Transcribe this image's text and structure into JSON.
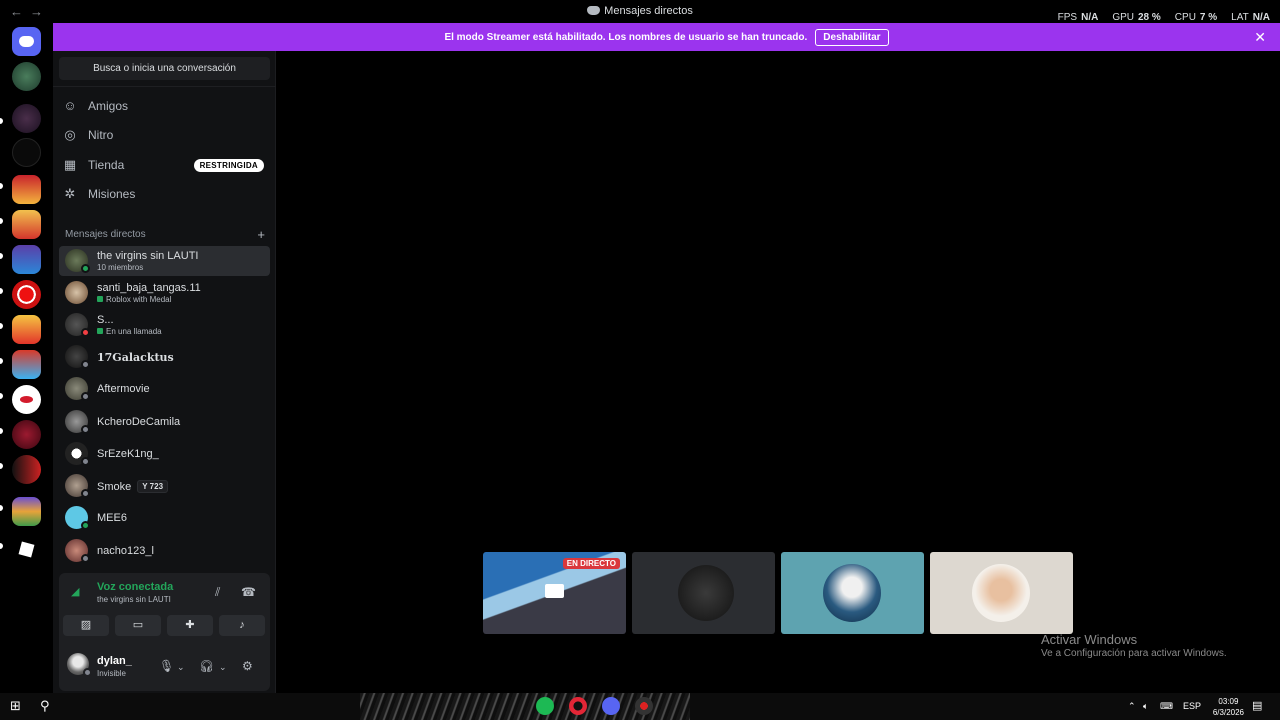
{
  "window": {
    "title": "Mensajes directos",
    "stats": [
      {
        "label": "FPS",
        "value": "N/A"
      },
      {
        "label": "GPU",
        "value": "28 %"
      },
      {
        "label": "CPU",
        "value": "7 %"
      },
      {
        "label": "LAT",
        "value": "N/A"
      }
    ]
  },
  "banner": {
    "text": "El modo Streamer está habilitado. Los nombres de usuario se han truncado.",
    "button": "Deshabilitar"
  },
  "sidebar": {
    "search_label": "Busca o inicia una conversación",
    "nav": [
      {
        "label": "Amigos",
        "icon": "friends-icon"
      },
      {
        "label": "Nitro",
        "icon": "nitro-icon"
      },
      {
        "label": "Tienda",
        "icon": "shop-icon",
        "badge": "RESTRINGIDA"
      },
      {
        "label": "Misiones",
        "icon": "quests-icon"
      }
    ],
    "dm_header": "Mensajes directos",
    "dms": [
      {
        "name": "the virgins sin LAUTI",
        "sub": "10 miembros",
        "active": true
      },
      {
        "name": "santi_baja_tangas.11",
        "sub": "Roblox with Medal",
        "status": "online"
      },
      {
        "name": "S...",
        "sub": "En una llamada",
        "status": "dnd"
      },
      {
        "name": "17Galacktus",
        "status": "offline"
      },
      {
        "name": "Aftermovie",
        "status": "offline"
      },
      {
        "name": "KcheroDeCamila",
        "status": "offline"
      },
      {
        "name": "SrEzeK1ng_",
        "status": "offline"
      },
      {
        "name": "Smoke",
        "tag": "Y 723",
        "status": "offline"
      },
      {
        "name": "MEE6",
        "status": "online"
      },
      {
        "name": "nacho123_l",
        "status": "offline"
      }
    ]
  },
  "voice": {
    "title": "Voz conectada",
    "channel": "the virgins sin LAUTI"
  },
  "user": {
    "name": "dylan_",
    "status": "Invisible"
  },
  "stage": {
    "live_badge": "EN DIRECTO",
    "activation_title": "Activar Windows",
    "activation_sub": "Ve a Configuración para activar Windows."
  },
  "taskbar": {
    "lang": "ESP",
    "time": "03:09",
    "date": "6/3/2026"
  },
  "colors": {
    "banner": "#9b34ee",
    "online": "#23a55a",
    "dnd": "#f23f43",
    "offline": "#80848e"
  }
}
